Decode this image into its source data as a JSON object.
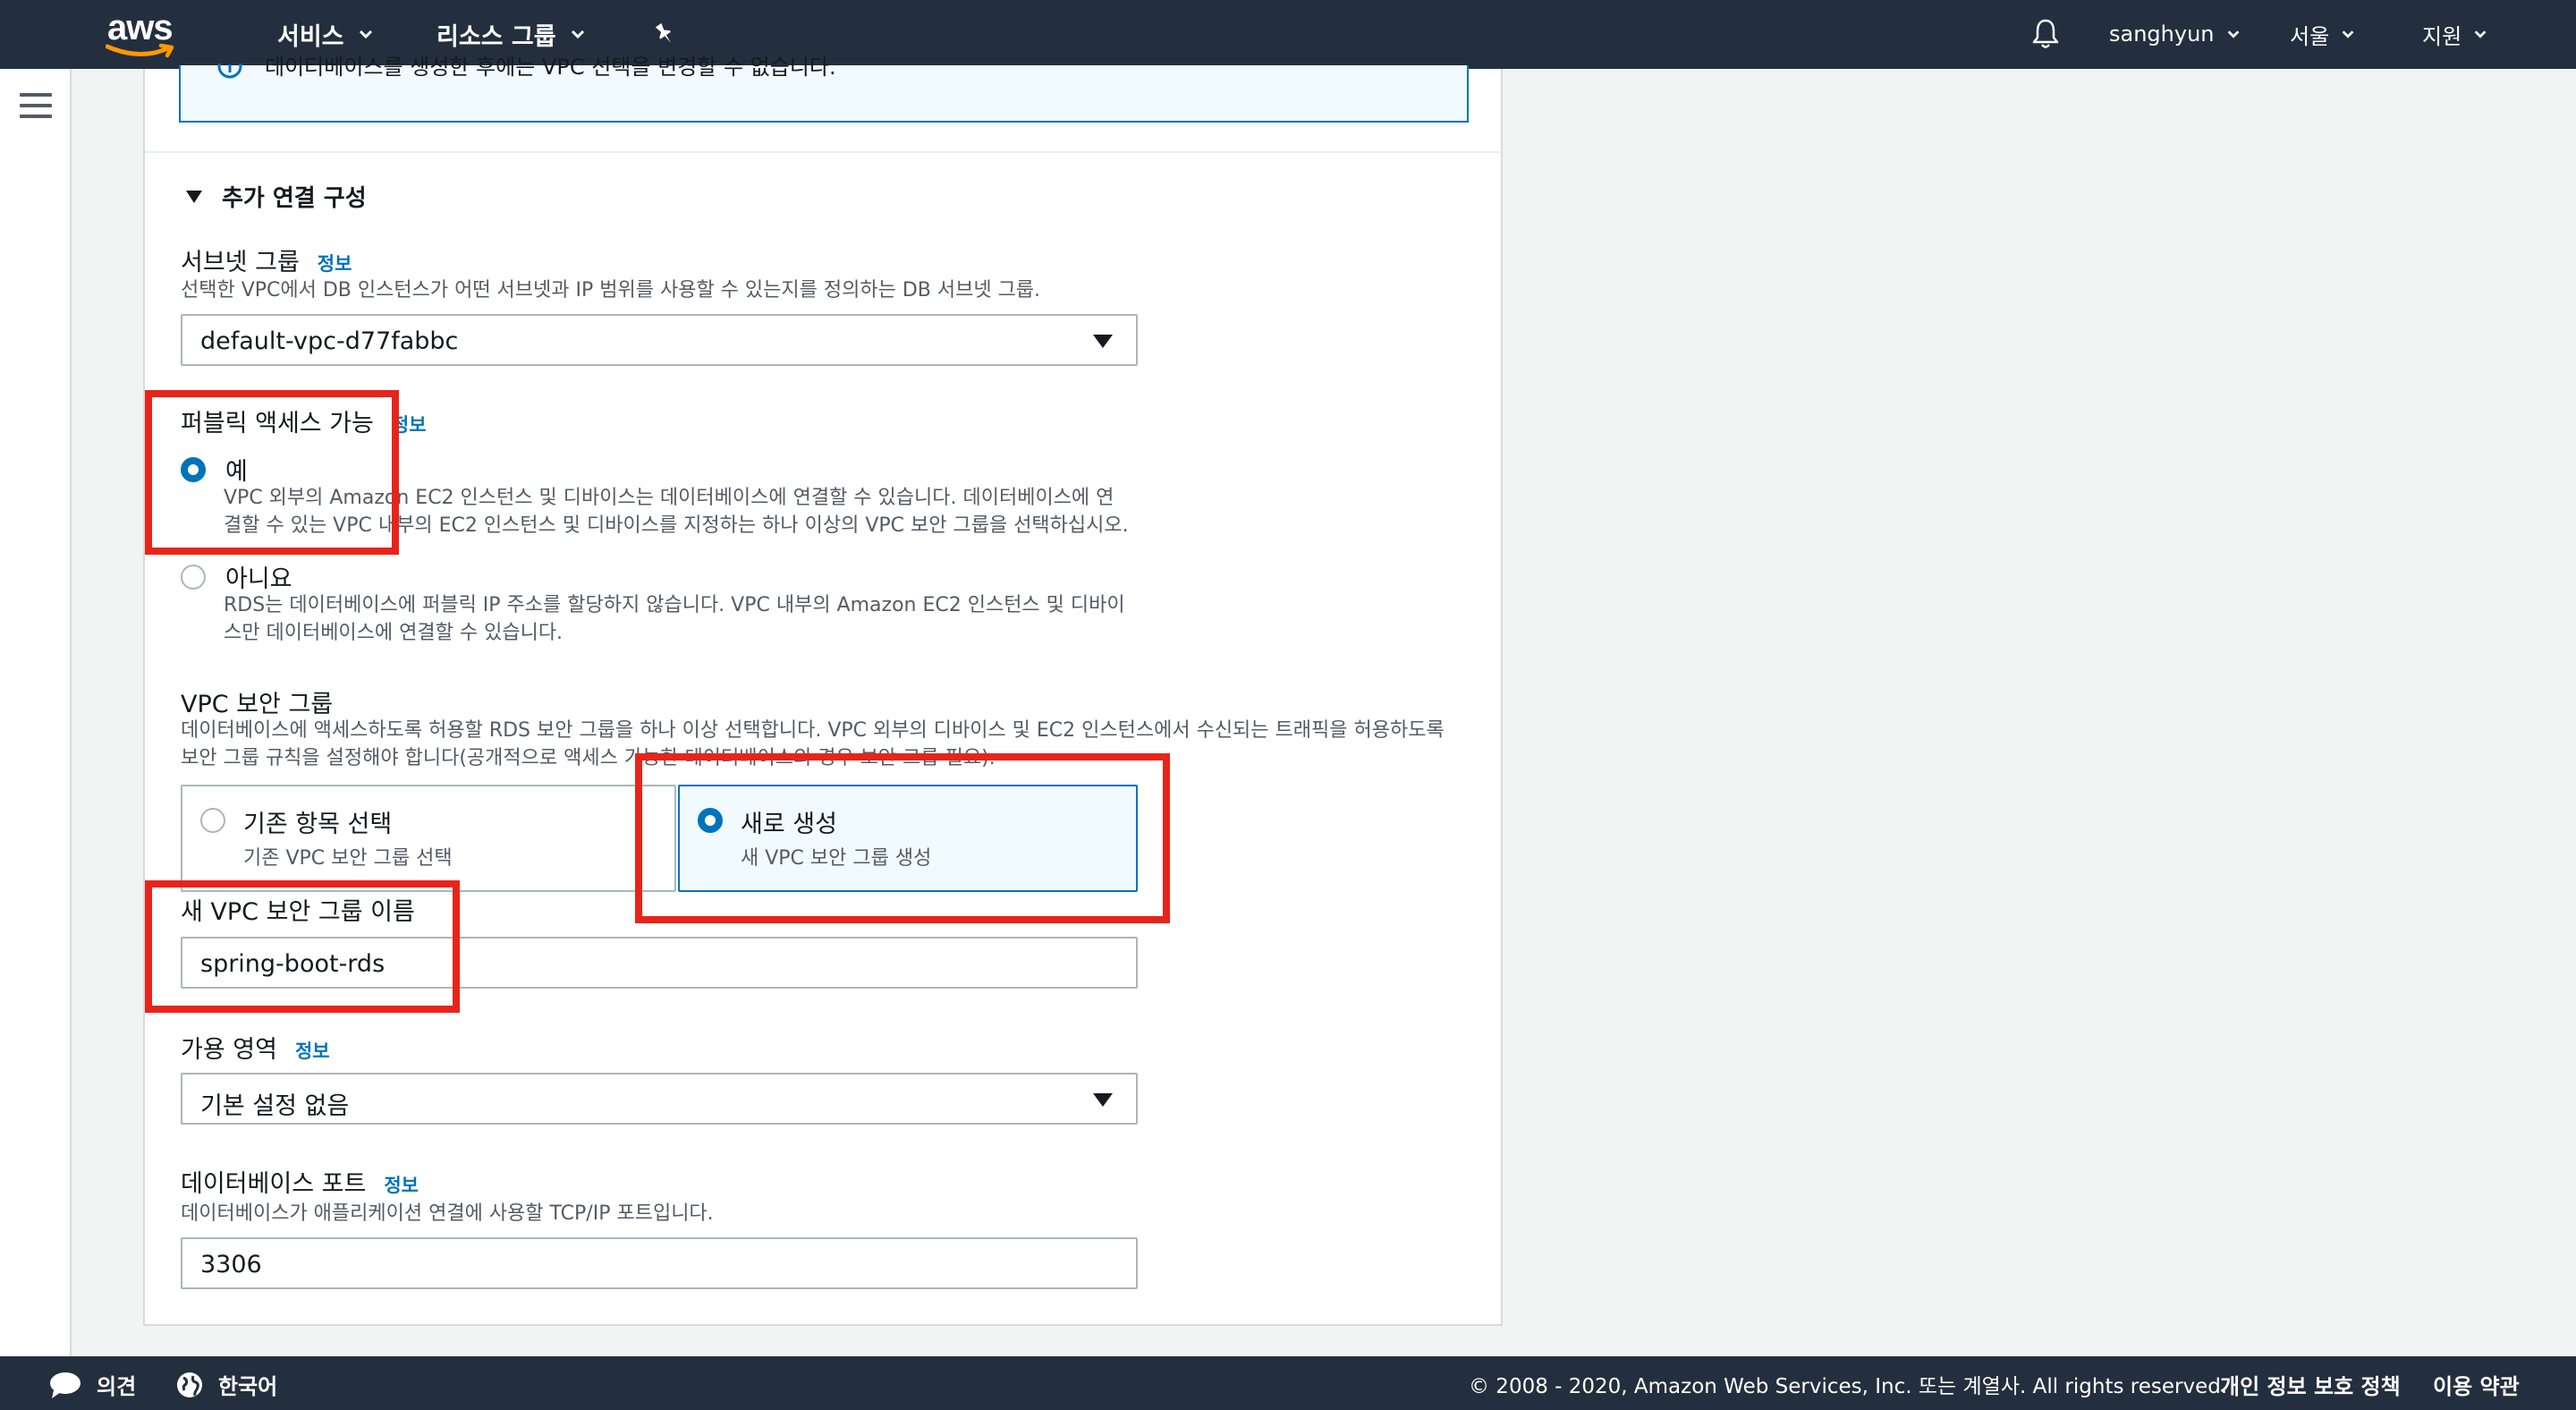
{
  "topnav": {
    "logo_text": "aws",
    "services": "서비스",
    "resource_groups": "리소스 그룹",
    "user": "sanghyun",
    "region": "서울",
    "support": "지원"
  },
  "banner": {
    "text": "데이터베이스를 생성한 후에는 VPC 선택을 변경할 수 없습니다."
  },
  "section": {
    "title": "추가 연결 구성"
  },
  "subnet_group": {
    "label": "서브넷 그룹",
    "info": "정보",
    "description": "선택한 VPC에서 DB 인스턴스가 어떤 서브넷과 IP 범위를 사용할 수 있는지를 정의하는 DB 서브넷 그룹.",
    "value": "default-vpc-d77fabbc"
  },
  "public_access": {
    "label": "퍼블릭 액세스 가능",
    "info": "정보",
    "yes_label": "예",
    "yes_desc_1": "VPC 외부의 Amazon EC2 인스턴스 및 디바이스는 데이터베이스에 연결할 수 있습니다. 데이터베이스에 연",
    "yes_desc_2": "결할 수 있는 VPC 내부의 EC2 인스턴스 및 디바이스를 지정하는 하나 이상의 VPC 보안 그룹을 선택하십시오.",
    "no_label": "아니요",
    "no_desc_1": "RDS는 데이터베이스에 퍼블릭 IP 주소를 할당하지 않습니다. VPC 내부의 Amazon EC2 인스턴스 및 디바이",
    "no_desc_2": "스만 데이터베이스에 연결할 수 있습니다."
  },
  "vpc_security_group": {
    "label": "VPC 보안 그룹",
    "desc_1": "데이터베이스에 액세스하도록 허용할 RDS 보안 그룹을 하나 이상 선택합니다. VPC 외부의 디바이스 및 EC2 인스턴스에서 수신되는 트래픽을 허용하도록",
    "desc_2": "보안 그룹 규칙을 설정해야 합니다(공개적으로 액세스 가능한 데이터베이스의 경우 보안 그룹 필요).",
    "existing_title": "기존 항목 선택",
    "existing_desc": "기존 VPC 보안 그룹 선택",
    "new_title": "새로 생성",
    "new_desc": "새 VPC 보안 그룹 생성"
  },
  "new_sg_name": {
    "label": "새 VPC 보안 그룹 이름",
    "value": "spring-boot-rds"
  },
  "availability_zone": {
    "label": "가용 영역",
    "info": "정보",
    "value": "기본 설정 없음"
  },
  "db_port": {
    "label": "데이터베이스 포트",
    "info": "정보",
    "description": "데이터베이스가 애플리케이션 연결에 사용할 TCP/IP 포트입니다.",
    "value": "3306"
  },
  "footer": {
    "feedback": "의견",
    "language": "한국어",
    "copyright": "© 2008 - 2020, Amazon Web Services, Inc. 또는 계열사. All rights reserved.",
    "privacy": "개인 정보 보호 정책",
    "terms": "이용 약관"
  },
  "colors": {
    "nav_bg": "#232f3e",
    "accent": "#0073bb",
    "logo_orange": "#ff9900",
    "highlight": "#e8241a"
  }
}
